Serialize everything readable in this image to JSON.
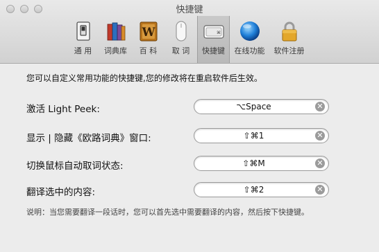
{
  "window": {
    "title": "快捷键"
  },
  "toolbar": {
    "items": [
      {
        "label": "通 用",
        "icon": "switch-icon"
      },
      {
        "label": "词典库",
        "icon": "books-icon"
      },
      {
        "label": "百 科",
        "icon": "wiki-book-icon"
      },
      {
        "label": "取 词",
        "icon": "mouse-icon"
      },
      {
        "label": "快捷键",
        "icon": "keyboard-key-icon",
        "selected": true
      },
      {
        "label": "在线功能",
        "icon": "globe-icon"
      },
      {
        "label": "软件注册",
        "icon": "padlock-icon"
      }
    ]
  },
  "content": {
    "intro": "您可以自定义常用功能的快捷键,您的修改将在重启软件后生效。",
    "rows": [
      {
        "label": "激活 Light Peek:",
        "value": "⌥Space"
      },
      {
        "label": "显示 | 隐藏《欧路词典》窗口:",
        "value": "⇧⌘1"
      },
      {
        "label": "切换鼠标自动取词状态:",
        "value": "⇧⌘M"
      },
      {
        "label": "翻译选中的内容:",
        "value": "⇧⌘2"
      }
    ],
    "note": "说明：当您需要翻译一段话时，您可以首先选中需要翻译的内容，然后按下快捷键。"
  },
  "colors": {
    "window_bg": "#ececec",
    "clear_button": "#9b9b9b"
  }
}
